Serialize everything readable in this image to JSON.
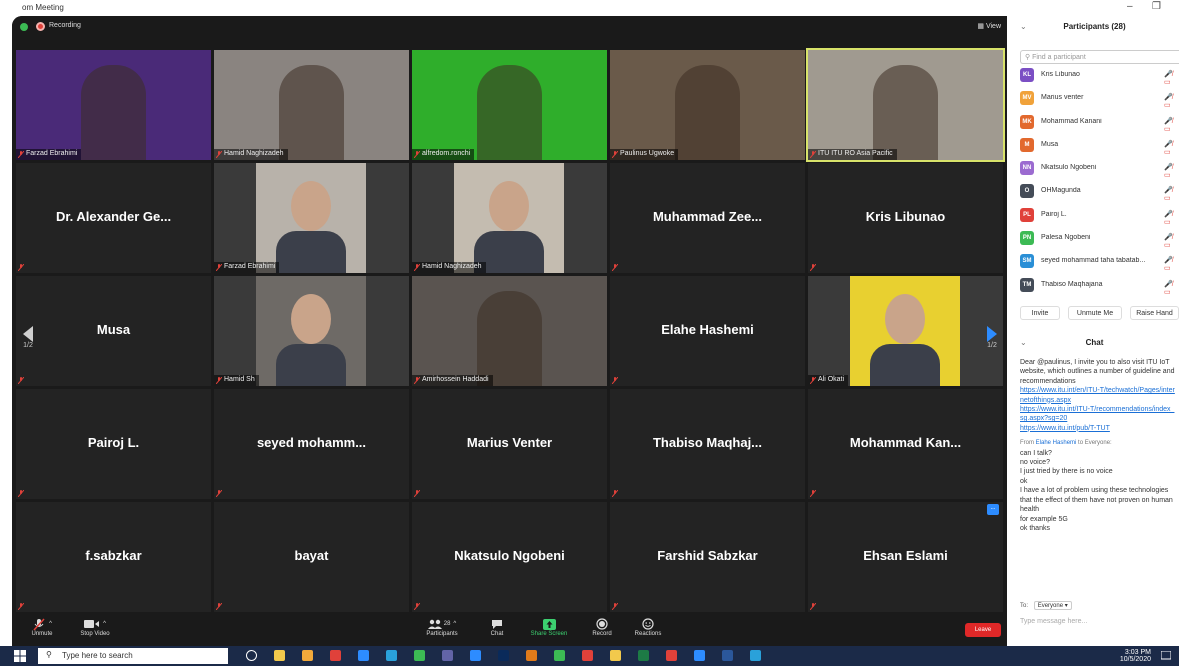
{
  "window": {
    "title": "Zoom Meeting",
    "title_visible": "om Meeting"
  },
  "topbar": {
    "recording_label": "Recording",
    "view_label": "View",
    "view_icon": "grid-icon"
  },
  "tiles": [
    {
      "name": "Farzad Ebrahimi",
      "type": "video",
      "bg": "#4a2a78"
    },
    {
      "name": "Hamid Naghizadeh",
      "type": "video",
      "bg": "#8a8480"
    },
    {
      "name": "alfredom.ronchi",
      "type": "video",
      "bg": "#2fae2b"
    },
    {
      "name": "Paulinus Ugwoke",
      "type": "video",
      "bg": "#6a5a4a"
    },
    {
      "name": "ITU ITU RO Asia Pacific",
      "type": "video",
      "bg": "#a09a90"
    },
    {
      "name": "Dr. Alexander Ge...",
      "type": "name"
    },
    {
      "name": "Farzad Ebrahimi",
      "type": "photo",
      "bg": "#b8b2aa"
    },
    {
      "name": "Hamid Naghizadeh",
      "type": "photo",
      "bg": "#c4bcb0"
    },
    {
      "name": "Muhammad Zee...",
      "type": "name"
    },
    {
      "name": "Kris Libunao",
      "type": "name"
    },
    {
      "name": "Musa",
      "type": "name"
    },
    {
      "name": "Hamid Sh",
      "type": "photo",
      "bg": "#6e6a66"
    },
    {
      "name": "Amirhossein Haddadi",
      "type": "video",
      "bg": "#5a5450"
    },
    {
      "name": "Elahe Hashemi",
      "type": "name"
    },
    {
      "name": "Ali Okati",
      "type": "photo",
      "bg": "#e8d030"
    },
    {
      "name": "Pairoj L.",
      "type": "name"
    },
    {
      "name": "seyed mohamm...",
      "type": "name"
    },
    {
      "name": "Marius Venter",
      "type": "name"
    },
    {
      "name": "Thabiso Maqhaj...",
      "type": "name"
    },
    {
      "name": "Mohammad Kan...",
      "type": "name"
    },
    {
      "name": "f.sabzkar",
      "type": "name"
    },
    {
      "name": "bayat",
      "type": "name"
    },
    {
      "name": "Nkatsulo Ngobeni",
      "type": "name"
    },
    {
      "name": "Farshid Sabzkar",
      "type": "name"
    },
    {
      "name": "Ehsan Eslami",
      "type": "name"
    }
  ],
  "nav": {
    "page_left": "1/2",
    "page_right": "1/2"
  },
  "controls": {
    "unmute": "Unmute",
    "stop_video": "Stop Video",
    "participants": "Participants",
    "participants_count": "28",
    "chat": "Chat",
    "share_screen": "Share Screen",
    "record": "Record",
    "reactions": "Reactions",
    "leave": "Leave"
  },
  "chat_badge": "...",
  "participants_panel": {
    "title": "Participants (28)",
    "search_placeholder": "Find a participant",
    "list": [
      {
        "initials": "KL",
        "name": "Kris Libunao",
        "color": "#7b4fc4"
      },
      {
        "initials": "MV",
        "name": "Marius venter",
        "color": "#f0a23a"
      },
      {
        "initials": "MK",
        "name": "Mohammad Kanani",
        "color": "#e2692e"
      },
      {
        "initials": "M",
        "name": "Musa",
        "color": "#e2692e"
      },
      {
        "initials": "NN",
        "name": "Nkatsulo Ngobeni",
        "color": "#9b6bd0"
      },
      {
        "initials": "O",
        "name": "OHMagunda",
        "color": "#444c58"
      },
      {
        "initials": "PL",
        "name": "Pairoj L.",
        "color": "#e0413a"
      },
      {
        "initials": "PN",
        "name": "Palesa Ngobeni",
        "color": "#3cba54"
      },
      {
        "initials": "SM",
        "name": "seyed mohammad taha tabatab...",
        "color": "#2a8fd6"
      },
      {
        "initials": "TM",
        "name": "Thabiso Maqhajana",
        "color": "#444c58"
      }
    ],
    "invite": "Invite",
    "unmute_me": "Unmute Me",
    "raise_hand": "Raise Hand"
  },
  "chat_panel": {
    "title": "Chat",
    "message1": "Dear @paulinus, I invite you to also visit ITU IoT website, which outlines a number of guideline and recommendations",
    "link1": "https://www.itu.int/en/ITU-T/techwatch/Pages/internetofthings.aspx",
    "link2": "https://www.itu.int/ITU-T/recommendations/index_sg.aspx?sg=20",
    "link3": "https://www.itu.int/pub/T-TUT",
    "from_prefix": "From",
    "from_name": "Elahe Hashemi",
    "from_suffix": "to Everyone:",
    "lines": [
      "can I talk?",
      "no voice?",
      "I just tried by there is no voice",
      "ok",
      "I have a lot of problem using these technologies",
      "that the effect of them have not proven on human health",
      "for example 5G",
      "ok thanks"
    ],
    "to_label": "To:",
    "to_value": "Everyone",
    "input_placeholder": "Type message here..."
  },
  "taskbar": {
    "search_placeholder": "Type here to search",
    "time": "3:03 PM",
    "date": "10/5/2020"
  }
}
